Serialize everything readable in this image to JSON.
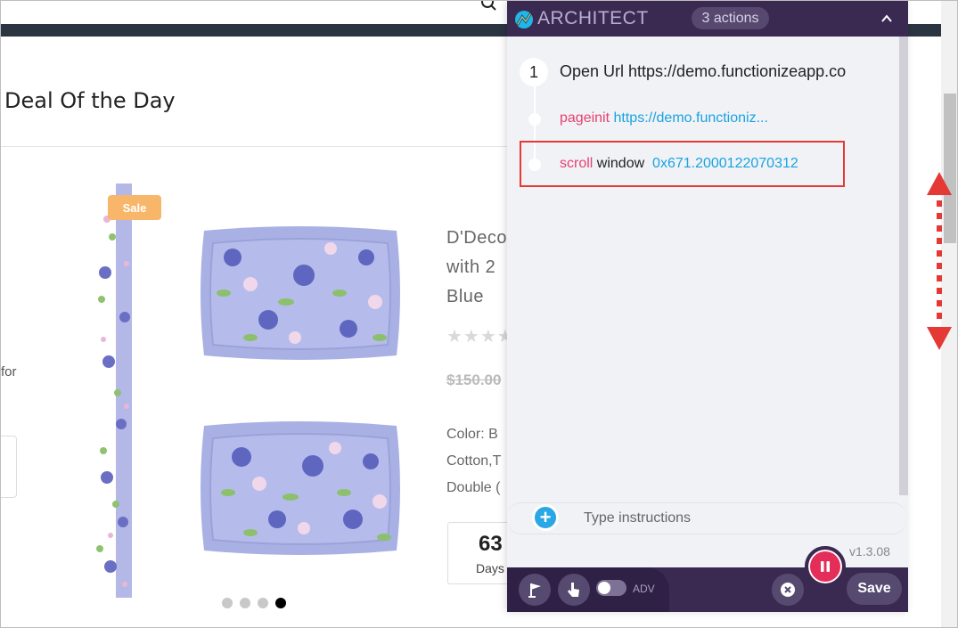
{
  "page": {
    "deal_title": "Deal Of the Day",
    "for_text": "for",
    "sale_badge": "Sale",
    "product_title_lines": [
      "D'Deco",
      "with 2",
      "Blue"
    ],
    "stars": "★★★★",
    "old_price": "$150.00",
    "desc_lines": [
      "Color: B",
      "Cotton,T",
      "Double ("
    ],
    "countdown": {
      "value": "63",
      "label": "Days"
    },
    "carousel": {
      "count": 4,
      "active_index": 3
    }
  },
  "architect": {
    "brand": "ARCHITECT",
    "actions_count": "3 actions",
    "steps": [
      {
        "number": "1",
        "title": "Open Url https://demo.functionizeapp.com",
        "sub_actions": [
          {
            "keyword": "pageinit",
            "target": "",
            "value": "https://demo.functioniz..."
          },
          {
            "keyword": "scroll",
            "target": "window",
            "value": "0x671.2000122070312"
          }
        ]
      }
    ],
    "instructions_placeholder": "Type instructions",
    "version": "v1.3.08",
    "adv_label": "ADV",
    "save_label": "Save",
    "icons": {
      "logo": "architect-logo-icon",
      "collapse": "chevron-up-icon",
      "add": "plus-icon",
      "flag": "flag-icon",
      "pointer": "cursor-hand-icon",
      "cancel": "close-icon",
      "pause": "pause-icon"
    },
    "colors": {
      "header": "#3a2a52",
      "keyword": "#e83f6f",
      "value": "#1aa3e0",
      "highlight": "#e53935",
      "pause": "#e52d5a"
    }
  }
}
